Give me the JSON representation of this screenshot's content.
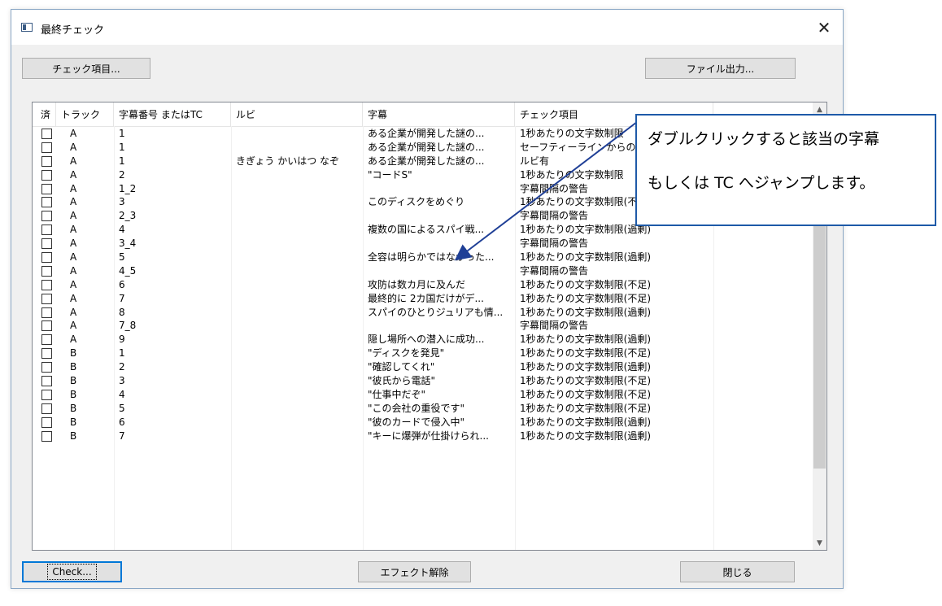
{
  "window": {
    "title": "最終チェック",
    "close_symbol": "✕"
  },
  "buttons": {
    "check_items": "チェック項目...",
    "file_output": "ファイル出力...",
    "check": "Check...",
    "effect_clear": "エフェクト解除",
    "close": "閉じる"
  },
  "table": {
    "columns": [
      "済",
      "トラック",
      "字幕番号 またはTC",
      "ルビ",
      "字幕",
      "チェック項目"
    ],
    "rows": [
      {
        "track": "A",
        "num": "1",
        "ruby": "",
        "sub": "ある企業が開発した謎の...",
        "check": "1秒あたりの文字数制限"
      },
      {
        "track": "A",
        "num": "1",
        "ruby": "",
        "sub": "ある企業が開発した謎の...",
        "check": "セーフティーラインからの("
      },
      {
        "track": "A",
        "num": "1",
        "ruby": "きぎょう かいはつ なぞ",
        "sub": "ある企業が開発した謎の...",
        "check": "ルビ有"
      },
      {
        "track": "A",
        "num": "2",
        "ruby": "",
        "sub": "\"コードS\"",
        "check": "1秒あたりの文字数制限"
      },
      {
        "track": "A",
        "num": "1_2",
        "ruby": "",
        "sub": "",
        "check": "字幕間隔の警告"
      },
      {
        "track": "A",
        "num": "3",
        "ruby": "",
        "sub": "このディスクをめぐり",
        "check": "1秒あたりの文字数制限(不足)"
      },
      {
        "track": "A",
        "num": "2_3",
        "ruby": "",
        "sub": "",
        "check": "字幕間隔の警告"
      },
      {
        "track": "A",
        "num": "4",
        "ruby": "",
        "sub": "複数の国によるスパイ戦...",
        "check": "1秒あたりの文字数制限(過剰)"
      },
      {
        "track": "A",
        "num": "3_4",
        "ruby": "",
        "sub": "",
        "check": "字幕間隔の警告"
      },
      {
        "track": "A",
        "num": "5",
        "ruby": "",
        "sub": "全容は明らかではなかった...",
        "check": "1秒あたりの文字数制限(過剰)"
      },
      {
        "track": "A",
        "num": "4_5",
        "ruby": "",
        "sub": "",
        "check": "字幕間隔の警告"
      },
      {
        "track": "A",
        "num": "6",
        "ruby": "",
        "sub": "攻防は数カ月に及んだ",
        "check": "1秒あたりの文字数制限(不足)"
      },
      {
        "track": "A",
        "num": "7",
        "ruby": "",
        "sub": "最終的に 2カ国だけがデ...",
        "check": "1秒あたりの文字数制限(不足)"
      },
      {
        "track": "A",
        "num": "8",
        "ruby": "",
        "sub": "スパイのひとりジュリアも情...",
        "check": "1秒あたりの文字数制限(過剰)"
      },
      {
        "track": "A",
        "num": "7_8",
        "ruby": "",
        "sub": "",
        "check": "字幕間隔の警告"
      },
      {
        "track": "A",
        "num": "9",
        "ruby": "",
        "sub": "隠し場所への潜入に成功...",
        "check": "1秒あたりの文字数制限(過剰)"
      },
      {
        "track": "B",
        "num": "1",
        "ruby": "",
        "sub": "\"ディスクを発見\"",
        "check": "1秒あたりの文字数制限(不足)"
      },
      {
        "track": "B",
        "num": "2",
        "ruby": "",
        "sub": "\"確認してくれ\"",
        "check": "1秒あたりの文字数制限(過剰)"
      },
      {
        "track": "B",
        "num": "3",
        "ruby": "",
        "sub": "\"彼氏から電話\"",
        "check": "1秒あたりの文字数制限(不足)"
      },
      {
        "track": "B",
        "num": "4",
        "ruby": "",
        "sub": "\"仕事中だぞ\"",
        "check": "1秒あたりの文字数制限(不足)"
      },
      {
        "track": "B",
        "num": "5",
        "ruby": "",
        "sub": "\"この会社の重役です\"",
        "check": "1秒あたりの文字数制限(不足)"
      },
      {
        "track": "B",
        "num": "6",
        "ruby": "",
        "sub": "\"彼のカードで侵入中\"",
        "check": "1秒あたりの文字数制限(過剰)"
      },
      {
        "track": "B",
        "num": "7",
        "ruby": "",
        "sub": "\"キーに爆弾が仕掛けられ...",
        "check": "1秒あたりの文字数制限(過剰)"
      }
    ]
  },
  "callout": {
    "line1": "ダブルクリックすると該当の字幕",
    "line2": "もしくは TC へジャンプします。"
  },
  "colors": {
    "callout_border": "#1e5aa8",
    "arrow": "#1f3f96"
  }
}
